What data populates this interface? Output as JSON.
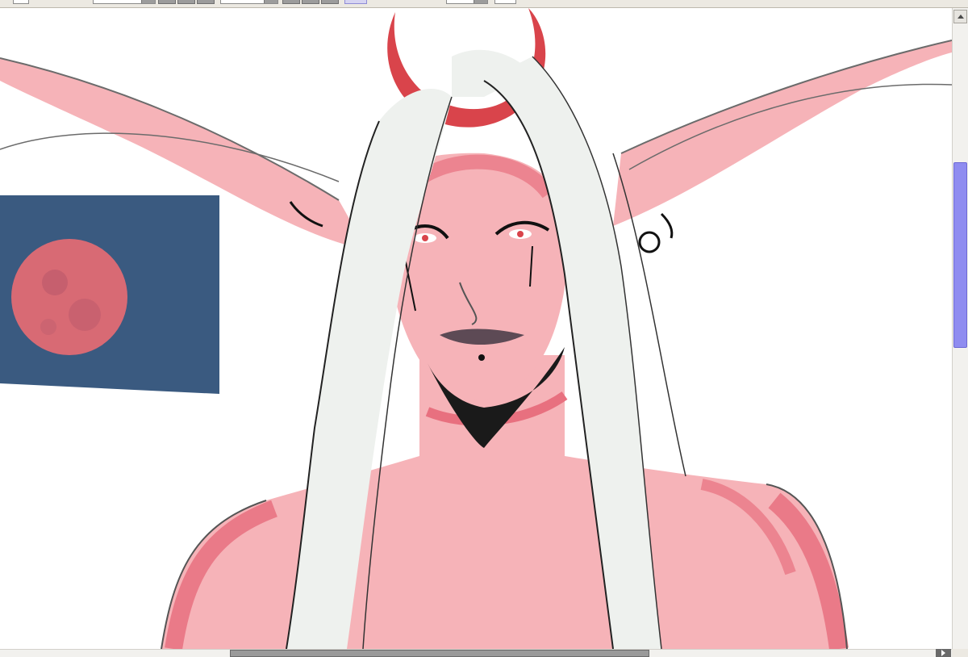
{
  "colors": {
    "toolbar_bg": "#ece9e2",
    "canvas_bg": "#ffffff",
    "skin": "#f6b3b8",
    "skin_shadow": "#e8707f",
    "hair": "#eef1ee",
    "crown": "#d9444b",
    "photo_bg": "#3a5a80",
    "moon": "#d86a74",
    "scroll_thumb": "#8f8cf0"
  },
  "toolbar": {
    "icons": [
      "dropdown",
      "dropdown",
      "button",
      "button",
      "button",
      "dropdown",
      "button",
      "button",
      "button",
      "selected-tool",
      "dropdown",
      "button"
    ]
  },
  "canvas": {
    "artwork": "sketch-illustration",
    "reference_image": "moon-photo"
  },
  "scrollbars": {
    "vertical_position": 0.35,
    "horizontal_position": 0.4
  }
}
